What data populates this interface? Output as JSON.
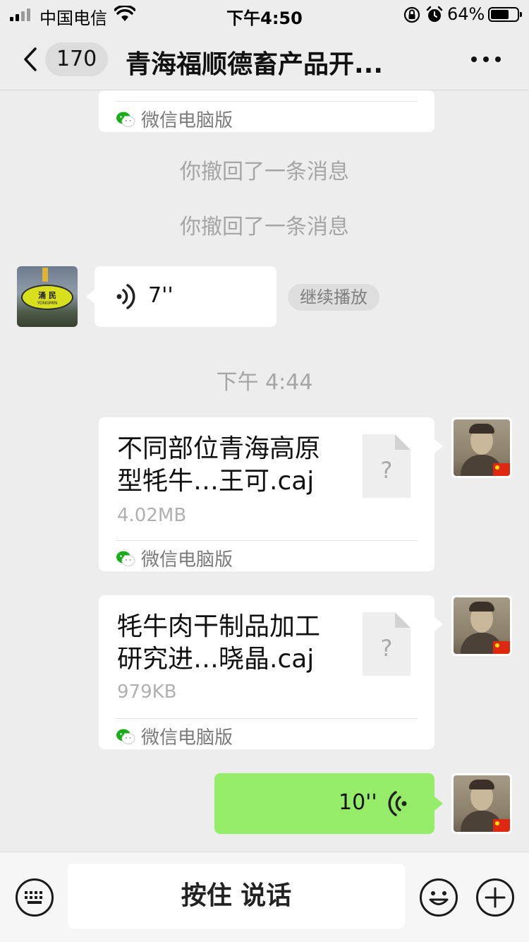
{
  "status_bar": {
    "carrier": "中国电信",
    "time": "下午4:50",
    "battery": "64%",
    "battery_level": 0.64
  },
  "nav": {
    "unread_count": "170",
    "title": "青海福顺德畜产品开..."
  },
  "messages": {
    "top_card_source": "微信电脑版",
    "recalled_1": "你撤回了一条消息",
    "recalled_2": "你撤回了一条消息",
    "voice_in_duration": "7''",
    "resume_play": "继续播放",
    "timestamp": "下午 4:44",
    "file1": {
      "name_line1": "不同部位青海高原",
      "name_line2": "型牦牛…王可.caj",
      "size": "4.02MB",
      "source": "微信电脑版"
    },
    "file2": {
      "name_line1": "牦牛肉干制品加工",
      "name_line2": "研究进…晓晶.caj",
      "size": "979KB",
      "source": "微信电脑版"
    },
    "voice_out_duration": "10''",
    "avatar_badge_text": "涌 民",
    "avatar_badge_subtext": "YONGMIN"
  },
  "bottom_bar": {
    "hold_to_talk": "按住 说话"
  },
  "colors": {
    "background": "#ededed",
    "voice_out_bubble": "#95ec69",
    "wechat_green": "#07c160"
  }
}
